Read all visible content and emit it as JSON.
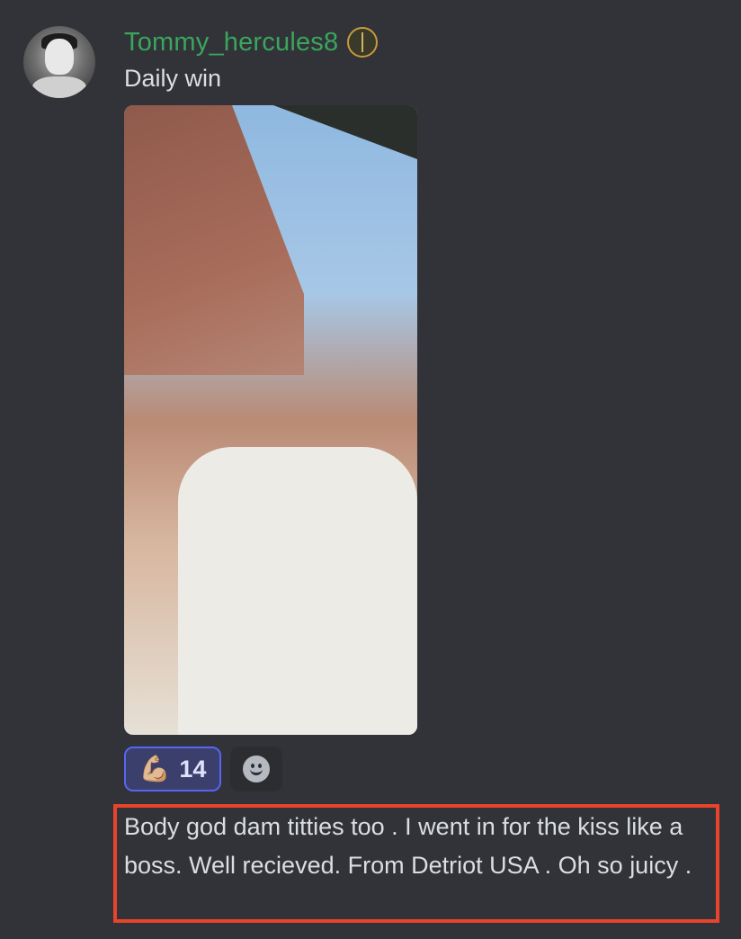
{
  "user": {
    "username": "Tommy_hercules8",
    "username_color": "#3ba55d",
    "badge_icon": "sword-badge-icon"
  },
  "message": {
    "text": "Daily win",
    "attachment": {
      "type": "photo",
      "alt": ""
    }
  },
  "reactions": [
    {
      "emoji": "💪🏼",
      "count": "14",
      "active": true
    },
    {
      "emoji": "add-reaction-icon",
      "count": "",
      "active": false
    }
  ],
  "annotation": {
    "text": "Body god dam titties too . I went in for the kiss like a boss. Well recieved. From Detriot USA . Oh so juicy .",
    "border_color": "#e8432b"
  },
  "colors": {
    "background": "#313338",
    "text": "#dbdee1",
    "reaction_active_bg": "#3b3f6b",
    "reaction_active_border": "#5865f2"
  }
}
